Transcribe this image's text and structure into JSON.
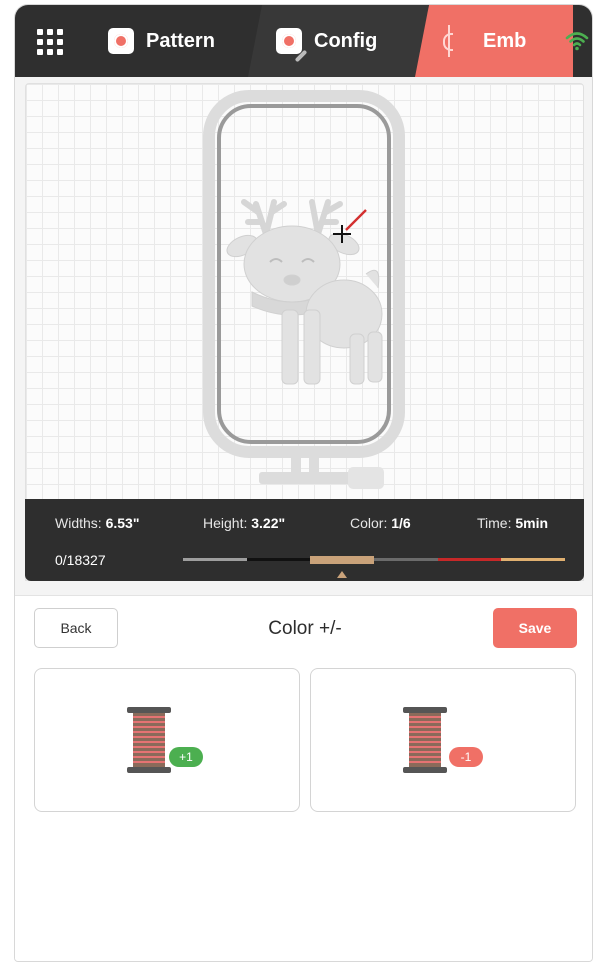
{
  "header": {
    "tabs": [
      {
        "label": "Pattern"
      },
      {
        "label": "Config"
      },
      {
        "label": "Emb",
        "active": true
      }
    ],
    "accent_color": "#f07066"
  },
  "info": {
    "width_label": "Widths:",
    "width_value": "6.53\"",
    "height_label": "Height:",
    "height_value": "3.22\"",
    "color_label": "Color:",
    "color_value": "1/6",
    "time_label": "Time:",
    "time_value": "5min",
    "stitch_count": "0/18327",
    "thread_colors": [
      "#9e9e9e",
      "#111111",
      "#c9a27a",
      "#6b6b6b",
      "#c62828",
      "#e0b070"
    ],
    "current_color_index": 2
  },
  "panel": {
    "back_label": "Back",
    "title": "Color +/-",
    "save_label": "Save",
    "plus_badge": "+1",
    "minus_badge": "-1"
  },
  "icons": [
    "apps-grid-icon",
    "pattern-icon",
    "config-icon",
    "needle-icon",
    "wifi-icon",
    "thread-spool-icon"
  ]
}
